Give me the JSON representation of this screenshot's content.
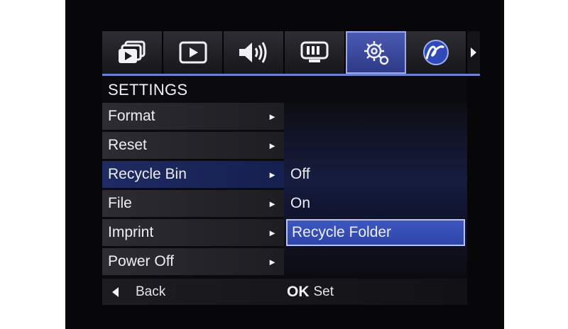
{
  "tabs": [
    {
      "icon": "photo-stack-icon",
      "active": false
    },
    {
      "icon": "play-icon",
      "active": false
    },
    {
      "icon": "speaker-icon",
      "active": false
    },
    {
      "icon": "display-icon",
      "active": false
    },
    {
      "icon": "gear-icon",
      "active": true
    },
    {
      "icon": "signature-icon",
      "active": false
    }
  ],
  "section_title": "SETTINGS",
  "menu": {
    "items": [
      {
        "label": "Format",
        "arrow": "►"
      },
      {
        "label": "Reset",
        "arrow": "►"
      },
      {
        "label": "Recycle Bin",
        "arrow": "►"
      },
      {
        "label": "File",
        "arrow": "►"
      },
      {
        "label": "Imprint",
        "arrow": "►"
      },
      {
        "label": "Power Off",
        "arrow": "►"
      }
    ]
  },
  "submenu": {
    "options": [
      {
        "label": "Off",
        "selected": false
      },
      {
        "label": "On",
        "selected": false
      },
      {
        "label": "Recycle Folder",
        "selected": true
      }
    ]
  },
  "bottom": {
    "back_label": "Back",
    "ok_key": "OK",
    "ok_label": "Set"
  },
  "colors": {
    "accent": "#3d57c0",
    "accent_border": "#b9c4f2",
    "underline": "#6f83d4"
  }
}
